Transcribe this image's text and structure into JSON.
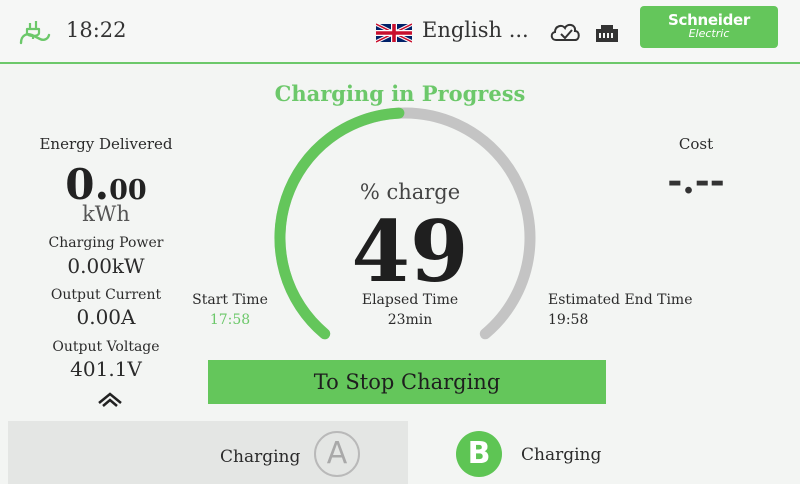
{
  "header": {
    "time": "18:22",
    "language": "English ...",
    "brand_name": "Schneider",
    "brand_sub": "Electric"
  },
  "status": {
    "title": "Charging in Progress",
    "charge_label": "% charge",
    "charge_percent": 49
  },
  "metrics": {
    "energy_label": "Energy Delivered",
    "energy_int": "0.",
    "energy_dec": "00",
    "energy_unit": "kWh",
    "power_label": "Charging Power",
    "power_value": "0.00kW",
    "current_label": "Output Current",
    "current_value": "0.00A",
    "voltage_label": "Output Voltage",
    "voltage_value": "401.1V"
  },
  "times": {
    "start_label": "Start Time",
    "start_value": "17:58",
    "elapsed_label": "Elapsed Time",
    "elapsed_value": "23min",
    "end_label": "Estimated End Time",
    "end_value": "19:58"
  },
  "cost": {
    "label": "Cost",
    "value": "-.--"
  },
  "actions": {
    "stop_label": "To Stop Charging"
  },
  "connectors": [
    {
      "id": "A",
      "status": "Charging"
    },
    {
      "id": "B",
      "status": "Charging"
    }
  ],
  "colors": {
    "accent": "#64c65b",
    "gauge_track": "#c4c4c4"
  }
}
